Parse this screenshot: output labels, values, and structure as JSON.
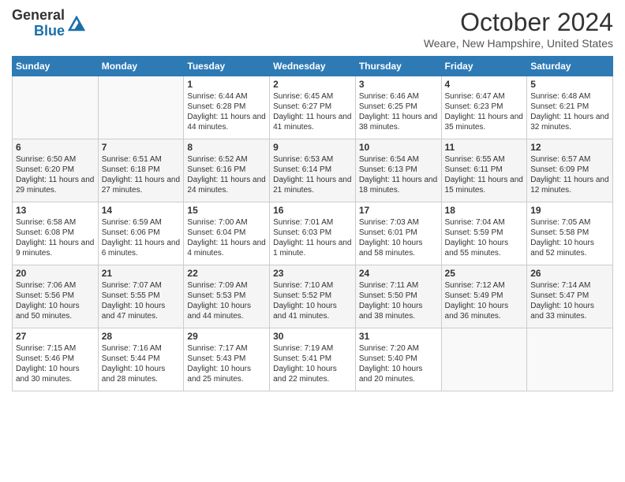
{
  "logo": {
    "line1": "General",
    "line2": "Blue"
  },
  "title": "October 2024",
  "location": "Weare, New Hampshire, United States",
  "weekdays": [
    "Sunday",
    "Monday",
    "Tuesday",
    "Wednesday",
    "Thursday",
    "Friday",
    "Saturday"
  ],
  "weeks": [
    [
      {
        "day": "",
        "text": ""
      },
      {
        "day": "",
        "text": ""
      },
      {
        "day": "1",
        "text": "Sunrise: 6:44 AM\nSunset: 6:28 PM\nDaylight: 11 hours and 44 minutes."
      },
      {
        "day": "2",
        "text": "Sunrise: 6:45 AM\nSunset: 6:27 PM\nDaylight: 11 hours and 41 minutes."
      },
      {
        "day": "3",
        "text": "Sunrise: 6:46 AM\nSunset: 6:25 PM\nDaylight: 11 hours and 38 minutes."
      },
      {
        "day": "4",
        "text": "Sunrise: 6:47 AM\nSunset: 6:23 PM\nDaylight: 11 hours and 35 minutes."
      },
      {
        "day": "5",
        "text": "Sunrise: 6:48 AM\nSunset: 6:21 PM\nDaylight: 11 hours and 32 minutes."
      }
    ],
    [
      {
        "day": "6",
        "text": "Sunrise: 6:50 AM\nSunset: 6:20 PM\nDaylight: 11 hours and 29 minutes."
      },
      {
        "day": "7",
        "text": "Sunrise: 6:51 AM\nSunset: 6:18 PM\nDaylight: 11 hours and 27 minutes."
      },
      {
        "day": "8",
        "text": "Sunrise: 6:52 AM\nSunset: 6:16 PM\nDaylight: 11 hours and 24 minutes."
      },
      {
        "day": "9",
        "text": "Sunrise: 6:53 AM\nSunset: 6:14 PM\nDaylight: 11 hours and 21 minutes."
      },
      {
        "day": "10",
        "text": "Sunrise: 6:54 AM\nSunset: 6:13 PM\nDaylight: 11 hours and 18 minutes."
      },
      {
        "day": "11",
        "text": "Sunrise: 6:55 AM\nSunset: 6:11 PM\nDaylight: 11 hours and 15 minutes."
      },
      {
        "day": "12",
        "text": "Sunrise: 6:57 AM\nSunset: 6:09 PM\nDaylight: 11 hours and 12 minutes."
      }
    ],
    [
      {
        "day": "13",
        "text": "Sunrise: 6:58 AM\nSunset: 6:08 PM\nDaylight: 11 hours and 9 minutes."
      },
      {
        "day": "14",
        "text": "Sunrise: 6:59 AM\nSunset: 6:06 PM\nDaylight: 11 hours and 6 minutes."
      },
      {
        "day": "15",
        "text": "Sunrise: 7:00 AM\nSunset: 6:04 PM\nDaylight: 11 hours and 4 minutes."
      },
      {
        "day": "16",
        "text": "Sunrise: 7:01 AM\nSunset: 6:03 PM\nDaylight: 11 hours and 1 minute."
      },
      {
        "day": "17",
        "text": "Sunrise: 7:03 AM\nSunset: 6:01 PM\nDaylight: 10 hours and 58 minutes."
      },
      {
        "day": "18",
        "text": "Sunrise: 7:04 AM\nSunset: 5:59 PM\nDaylight: 10 hours and 55 minutes."
      },
      {
        "day": "19",
        "text": "Sunrise: 7:05 AM\nSunset: 5:58 PM\nDaylight: 10 hours and 52 minutes."
      }
    ],
    [
      {
        "day": "20",
        "text": "Sunrise: 7:06 AM\nSunset: 5:56 PM\nDaylight: 10 hours and 50 minutes."
      },
      {
        "day": "21",
        "text": "Sunrise: 7:07 AM\nSunset: 5:55 PM\nDaylight: 10 hours and 47 minutes."
      },
      {
        "day": "22",
        "text": "Sunrise: 7:09 AM\nSunset: 5:53 PM\nDaylight: 10 hours and 44 minutes."
      },
      {
        "day": "23",
        "text": "Sunrise: 7:10 AM\nSunset: 5:52 PM\nDaylight: 10 hours and 41 minutes."
      },
      {
        "day": "24",
        "text": "Sunrise: 7:11 AM\nSunset: 5:50 PM\nDaylight: 10 hours and 38 minutes."
      },
      {
        "day": "25",
        "text": "Sunrise: 7:12 AM\nSunset: 5:49 PM\nDaylight: 10 hours and 36 minutes."
      },
      {
        "day": "26",
        "text": "Sunrise: 7:14 AM\nSunset: 5:47 PM\nDaylight: 10 hours and 33 minutes."
      }
    ],
    [
      {
        "day": "27",
        "text": "Sunrise: 7:15 AM\nSunset: 5:46 PM\nDaylight: 10 hours and 30 minutes."
      },
      {
        "day": "28",
        "text": "Sunrise: 7:16 AM\nSunset: 5:44 PM\nDaylight: 10 hours and 28 minutes."
      },
      {
        "day": "29",
        "text": "Sunrise: 7:17 AM\nSunset: 5:43 PM\nDaylight: 10 hours and 25 minutes."
      },
      {
        "day": "30",
        "text": "Sunrise: 7:19 AM\nSunset: 5:41 PM\nDaylight: 10 hours and 22 minutes."
      },
      {
        "day": "31",
        "text": "Sunrise: 7:20 AM\nSunset: 5:40 PM\nDaylight: 10 hours and 20 minutes."
      },
      {
        "day": "",
        "text": ""
      },
      {
        "day": "",
        "text": ""
      }
    ]
  ]
}
